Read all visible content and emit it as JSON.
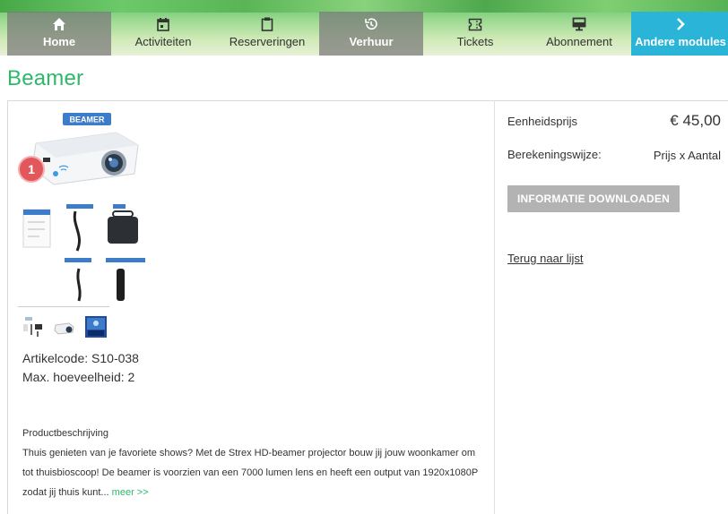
{
  "nav": {
    "items": [
      {
        "label": "Home",
        "icon": "home-icon",
        "style": "dark"
      },
      {
        "label": "Activiteiten",
        "icon": "calendar-icon",
        "style": "light"
      },
      {
        "label": "Reserveringen",
        "icon": "clipboard-icon",
        "style": "light"
      },
      {
        "label": "Verhuur",
        "icon": "history-icon",
        "style": "dark"
      },
      {
        "label": "Tickets",
        "icon": "ticket-icon",
        "style": "light"
      },
      {
        "label": "Abonnement",
        "icon": "monitor-icon",
        "style": "light"
      },
      {
        "label": "Andere modules",
        "icon": "chevron-right-icon",
        "style": "blue"
      }
    ]
  },
  "page": {
    "title": "Beamer"
  },
  "product": {
    "image_badge_text": "BEAMER",
    "marker_number": "1",
    "thumbnails": [
      "thumb-accessories",
      "thumb-projector",
      "thumb-screen"
    ],
    "article_code": "Artikelcode: S10-038",
    "max_quantity": "Max. hoeveelheid: 2",
    "description_heading": "Productbeschrijving",
    "description": "Thuis genieten van je favoriete shows? Met de Strex HD-beamer projector bouw jij jouw woonkamer om tot thuisbioscoop! De beamer is voorzien van een 7000 lumen lens en heeft een output van 1920x1080P zodat jij thuis kunt...",
    "more_link": "meer >>"
  },
  "pricing": {
    "unit_price_label": "Eenheidsprijs",
    "unit_price_value": "€ 45,00",
    "calc_label": "Berekeningswijze:",
    "calc_value": "Prijs x Aantal",
    "download_button": "INFORMATIE DOWNLOADEN",
    "back_link": "Terug naar lijst"
  },
  "colors": {
    "accent_green": "#2db86a",
    "nav_blue": "#29b4d8",
    "nav_dark": "#7d7d7d",
    "badge_red": "#e2575c"
  }
}
